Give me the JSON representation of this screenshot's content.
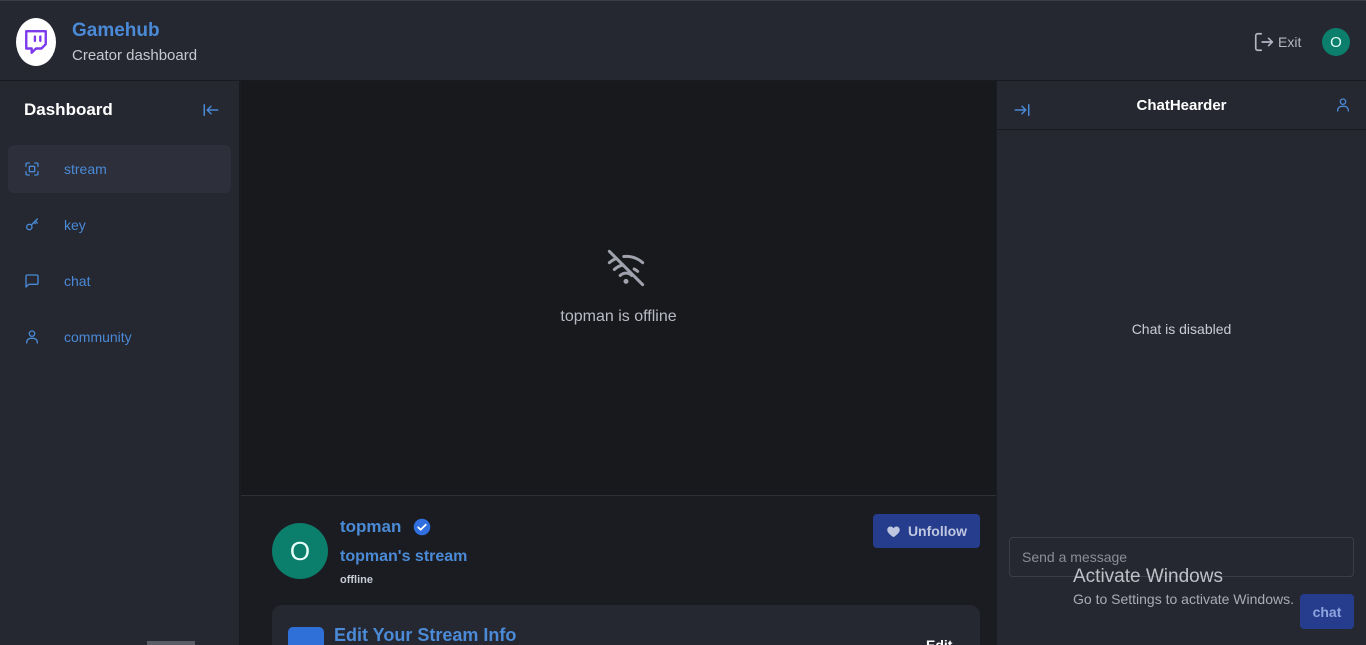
{
  "brand": {
    "title": "Gamehub",
    "subtitle": "Creator dashboard"
  },
  "header": {
    "exit_label": "Exit",
    "avatar_initial": "O"
  },
  "sidebar": {
    "title": "Dashboard",
    "items": [
      {
        "label": "stream",
        "icon": "fullscreen-icon",
        "active": true
      },
      {
        "label": "key",
        "icon": "key-icon",
        "active": false
      },
      {
        "label": "chat",
        "icon": "message-icon",
        "active": false
      },
      {
        "label": "community",
        "icon": "user-icon",
        "active": false
      }
    ]
  },
  "player": {
    "offline_text": "topman is offline",
    "icon": "wifi-off-icon"
  },
  "stream_info": {
    "avatar_initial": "O",
    "username": "topman",
    "stream_name": "topman's stream",
    "status": "offline",
    "unfollow_label": "Unfollow"
  },
  "edit_card": {
    "title": "Edit Your Stream Info",
    "edit_label": "Edit"
  },
  "chat": {
    "title": "ChatHearder",
    "disabled_text": "Chat is disabled",
    "input_placeholder": "Send a message",
    "send_label": "chat"
  },
  "watermark": {
    "title": "Activate Windows",
    "subtitle": "Go to Settings to activate Windows."
  },
  "colors": {
    "accent": "#4a8ad6",
    "button": "#253d8c",
    "avatar": "#0b7f6c",
    "logo_icon": "#7c3aed"
  }
}
